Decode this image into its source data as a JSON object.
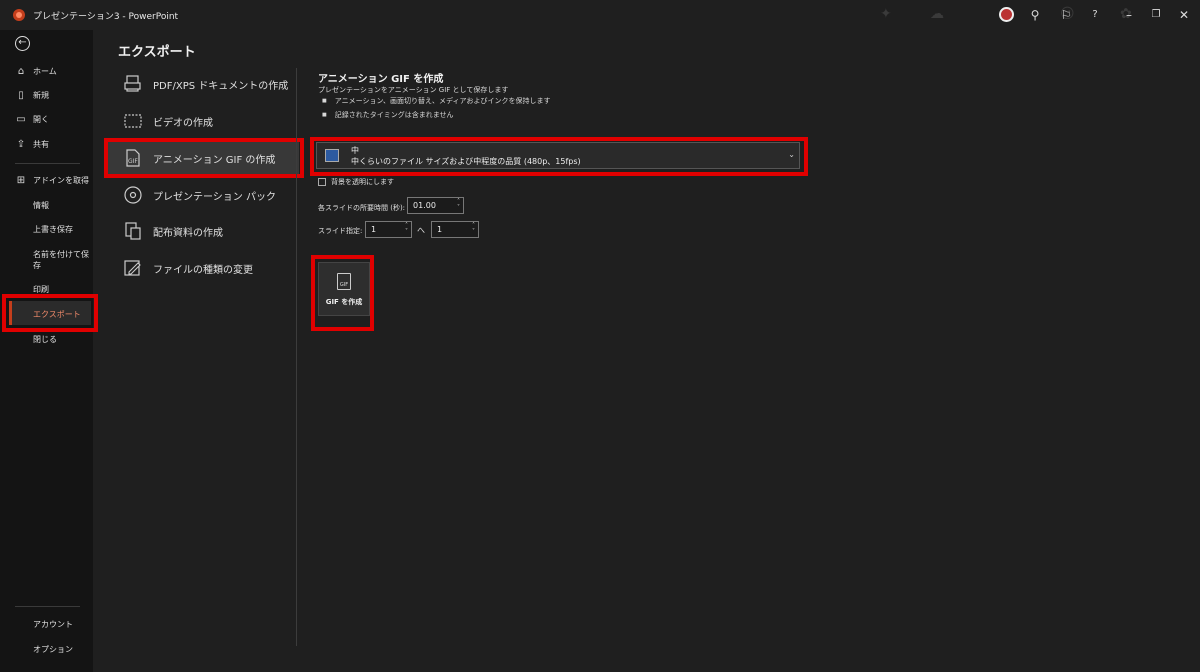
{
  "titlebar": {
    "title": "プレゼンテーション3 - PowerPoint"
  },
  "rail": {
    "items": [
      {
        "label": "ホーム",
        "icon": "home-icon"
      },
      {
        "label": "新規",
        "icon": "new-document-icon"
      },
      {
        "label": "開く",
        "icon": "folder-icon"
      },
      {
        "label": "共有",
        "icon": "share-icon"
      },
      {
        "label": "アドインを取得",
        "icon": "addins-icon"
      },
      {
        "label": "情報"
      },
      {
        "label": "上書き保存"
      },
      {
        "label": "名前を付けて保",
        "label2": "存"
      },
      {
        "label": "印刷"
      },
      {
        "label": "エクスポート"
      },
      {
        "label": "閉じる"
      },
      {
        "label": "アカウント"
      },
      {
        "label": "オプション"
      }
    ]
  },
  "main": {
    "title": "エクスポート",
    "options": [
      {
        "label": "PDF/XPS ドキュメントの作成",
        "icon": "pdf-xps-icon"
      },
      {
        "label": "ビデオの作成",
        "icon": "video-icon"
      },
      {
        "label": "アニメーション GIF の作成",
        "icon": "gif-icon"
      },
      {
        "label": "プレゼンテーション パック",
        "icon": "package-cd-icon"
      },
      {
        "label": "配布資料の作成",
        "icon": "handout-icon"
      },
      {
        "label": "ファイルの種類の変更",
        "icon": "change-file-type-icon"
      }
    ]
  },
  "gif_panel": {
    "title": "アニメーション GIF を作成",
    "description": "プレゼンテーションをアニメーション GIF として保存します",
    "bullets": [
      "アニメーション、画面切り替え、メディアおよびインクを保持します",
      "記録されたタイミングは含まれません"
    ],
    "quality": {
      "title": "中",
      "subtitle": "中くらいのファイル サイズおよび中程度の品質 (480p、15fps)"
    },
    "transparent_label": "背景を透明にします",
    "duration_label": "各スライドの所要時間 (秒):",
    "duration_value": "01.00",
    "slides_label": "スライド指定:",
    "slide_from": "1",
    "slides_to_label": "へ",
    "slide_to": "1",
    "create_button": "GIF を作成",
    "create_button_icon_text": "GIF"
  },
  "colors": {
    "accent": "#c43e1c",
    "highlight": "#e00000",
    "background": "#1f1f1f"
  }
}
